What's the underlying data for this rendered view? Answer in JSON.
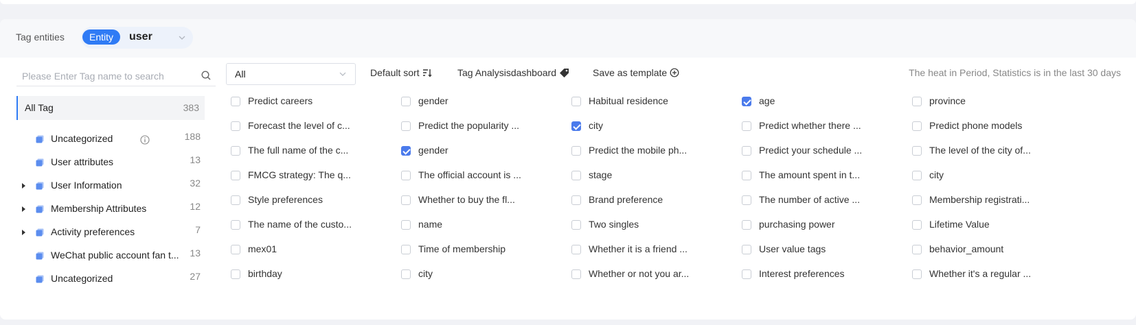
{
  "entity": {
    "label": "Tag entities",
    "pill": "Entity",
    "value": "user"
  },
  "search": {
    "placeholder": "Please Enter Tag name to search"
  },
  "all_tag": {
    "label": "All Tag",
    "count": "383"
  },
  "tree": [
    {
      "label": "Uncategorized",
      "count": "188",
      "expandable": false,
      "info": true
    },
    {
      "label": "User attributes",
      "count": "13",
      "expandable": false,
      "info": false
    },
    {
      "label": "User Information",
      "count": "32",
      "expandable": true,
      "info": false
    },
    {
      "label": "Membership Attributes",
      "count": "12",
      "expandable": true,
      "info": false
    },
    {
      "label": "Activity preferences",
      "count": "7",
      "expandable": true,
      "info": false
    },
    {
      "label": "WeChat public account fan t...",
      "count": "13",
      "expandable": false,
      "info": false
    },
    {
      "label": "Uncategorized",
      "count": "27",
      "expandable": false,
      "info": false
    }
  ],
  "toolbar": {
    "filter_value": "All",
    "sort_label": "Default sort",
    "dashboard_label": "Tag Analysisdashboard",
    "template_label": "Save as template",
    "period_note": "The heat in Period, Statistics is in the last 30 days"
  },
  "tags": [
    [
      {
        "label": "Predict careers",
        "checked": false
      },
      {
        "label": "gender",
        "checked": false
      },
      {
        "label": "Habitual residence",
        "checked": false
      },
      {
        "label": "age",
        "checked": true
      },
      {
        "label": "province",
        "checked": false
      }
    ],
    [
      {
        "label": "Forecast the level of c...",
        "checked": false
      },
      {
        "label": "Predict the popularity ...",
        "checked": false
      },
      {
        "label": "city",
        "checked": true
      },
      {
        "label": "Predict whether there ...",
        "checked": false
      },
      {
        "label": "Predict phone models",
        "checked": false
      }
    ],
    [
      {
        "label": "The full name of the c...",
        "checked": false
      },
      {
        "label": "gender",
        "checked": true
      },
      {
        "label": "Predict the mobile ph...",
        "checked": false
      },
      {
        "label": "Predict your schedule ...",
        "checked": false
      },
      {
        "label": "The level of the city of...",
        "checked": false
      }
    ],
    [
      {
        "label": "FMCG strategy: The q...",
        "checked": false
      },
      {
        "label": "The official account is ...",
        "checked": false
      },
      {
        "label": "stage",
        "checked": false
      },
      {
        "label": "The amount spent in t...",
        "checked": false
      },
      {
        "label": "city",
        "checked": false
      }
    ],
    [
      {
        "label": "Style preferences",
        "checked": false
      },
      {
        "label": "Whether to buy the fl...",
        "checked": false
      },
      {
        "label": "Brand preference",
        "checked": false
      },
      {
        "label": "The number of active ...",
        "checked": false
      },
      {
        "label": "Membership registrati...",
        "checked": false
      }
    ],
    [
      {
        "label": "The name of the custo...",
        "checked": false
      },
      {
        "label": "name",
        "checked": false
      },
      {
        "label": "Two singles",
        "checked": false
      },
      {
        "label": "purchasing power",
        "checked": false
      },
      {
        "label": "Lifetime Value",
        "checked": false
      }
    ],
    [
      {
        "label": "mex01",
        "checked": false
      },
      {
        "label": "Time of membership",
        "checked": false
      },
      {
        "label": "Whether it is a friend ...",
        "checked": false
      },
      {
        "label": "User value tags",
        "checked": false
      },
      {
        "label": "behavior_amount",
        "checked": false
      }
    ],
    [
      {
        "label": "birthday",
        "checked": false
      },
      {
        "label": "city",
        "checked": false
      },
      {
        "label": "Whether or not you ar...",
        "checked": false
      },
      {
        "label": "Interest preferences",
        "checked": false
      },
      {
        "label": "Whether it's a regular ...",
        "checked": false
      }
    ]
  ],
  "colors": {
    "accent": "#2f7bf5",
    "checkbox": "#4b7bec",
    "cube": "#5b8def"
  }
}
